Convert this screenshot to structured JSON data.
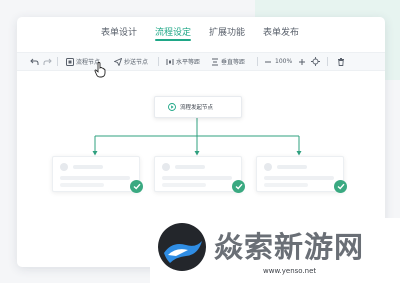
{
  "tabs": [
    {
      "label": "表单设计",
      "active": false
    },
    {
      "label": "流程设定",
      "active": true
    },
    {
      "label": "扩展功能",
      "active": false
    },
    {
      "label": "表单发布",
      "active": false
    }
  ],
  "toolbar": {
    "flow_node": "流程节点",
    "cc_node": "抄送节点",
    "h_equal": "水平等距",
    "v_equal": "垂直等距",
    "zoom": "100%"
  },
  "flow": {
    "start_node": "流程发起节点",
    "child_cards": 3
  },
  "watermark": {
    "text": "焱索新游网",
    "url": "www.yenso.net"
  },
  "colors": {
    "accent": "#1fa787",
    "check": "#3aa981"
  }
}
